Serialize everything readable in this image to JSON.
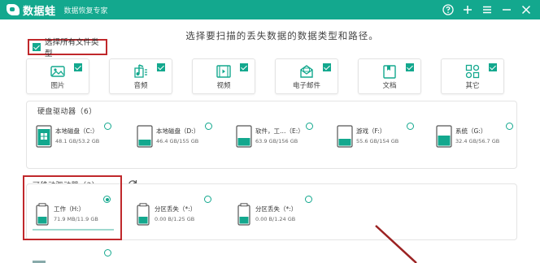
{
  "app": {
    "name": "数据蛙",
    "subtitle": "数据恢复专家",
    "colors": {
      "brand": "#13a88e",
      "highlight": "#c0282b"
    }
  },
  "window_controls": [
    {
      "icon": "help-icon"
    },
    {
      "icon": "plus-icon"
    },
    {
      "icon": "menu-icon"
    },
    {
      "icon": "minimize-icon"
    },
    {
      "icon": "close-icon"
    }
  ],
  "heading": "选择要扫描的丢失数据的数据类型和路径。",
  "select_all": {
    "label": "选择所有文件类型",
    "checked": true
  },
  "file_types": [
    {
      "label": "图片",
      "icon": "image-icon",
      "checked": true
    },
    {
      "label": "音频",
      "icon": "audio-icon",
      "checked": true
    },
    {
      "label": "视频",
      "icon": "video-icon",
      "checked": true
    },
    {
      "label": "电子邮件",
      "icon": "email-icon",
      "checked": true
    },
    {
      "label": "文档",
      "icon": "document-icon",
      "checked": true
    },
    {
      "label": "其它",
      "icon": "other-icon",
      "checked": true
    }
  ],
  "hard_drives": {
    "title": "硬盘驱动器（6）",
    "items": [
      {
        "name": "本地磁盘（C:）",
        "size": "48.1 GB/53.2 GB",
        "icon": "windows-drive-icon",
        "fill": 0.9,
        "selected": false
      },
      {
        "name": "本地磁盘（D:）",
        "size": "46.4 GB/155 GB",
        "icon": "hard-drive-icon",
        "fill": 0.3,
        "selected": false
      },
      {
        "name": "软件，工…（E:）",
        "size": "63.9 GB/156 GB",
        "icon": "hard-drive-icon",
        "fill": 0.41,
        "selected": false
      },
      {
        "name": "游戏（F:）",
        "size": "55.6 GB/154 GB",
        "icon": "hard-drive-icon",
        "fill": 0.36,
        "selected": false
      },
      {
        "name": "系统（G:）",
        "size": "32.4 GB/56.7 GB",
        "icon": "hard-drive-icon",
        "fill": 0.57,
        "selected": false
      }
    ]
  },
  "removable_drives": {
    "title": "可移动驱动器（3）",
    "refresh_icon": "refresh-icon",
    "items": [
      {
        "name": "工作（H:）",
        "size": "71.9 MB/11.9 GB",
        "icon": "usb-drive-icon",
        "selected": true
      },
      {
        "name": "分区丢失（*:）",
        "size": "0.00  B/1.25 GB",
        "icon": "usb-drive-icon",
        "selected": false
      },
      {
        "name": "分区丢失（*:）",
        "size": "0.00  B/1.24 GB",
        "icon": "usb-drive-icon",
        "selected": false
      }
    ]
  },
  "recycle": {
    "icon": "recycle-bin-icon"
  }
}
